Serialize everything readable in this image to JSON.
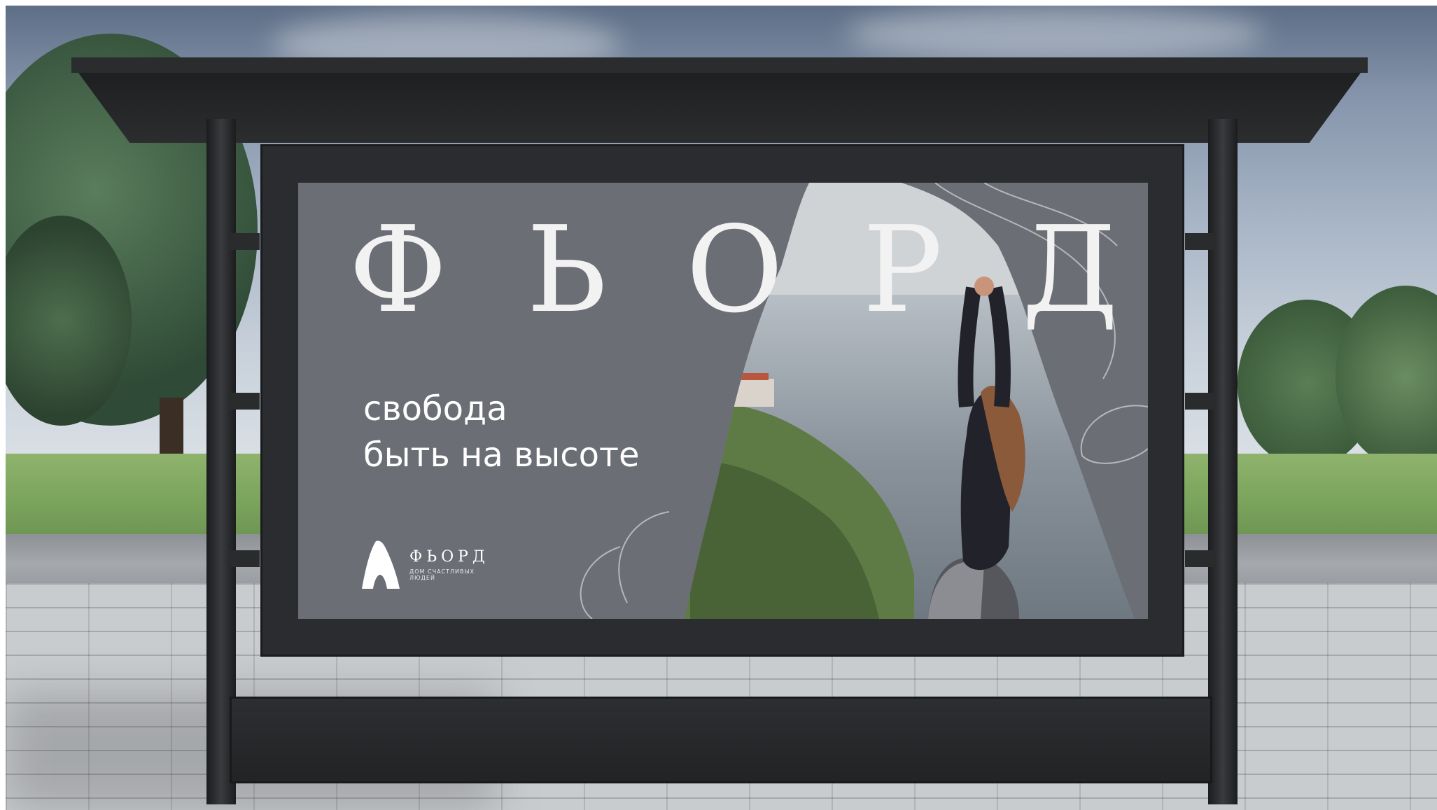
{
  "poster": {
    "brand_title": [
      "Ф",
      "Ь",
      "О",
      "Р",
      "Д"
    ],
    "tagline_line1": "свобода",
    "tagline_line2": "быть на высоте",
    "logo_name": "ФЬОРД",
    "logo_subtitle": "ДОМ СЧАСТЛИВЫХ ЛЮДЕЙ"
  },
  "colors": {
    "poster_background": "#6b6e75",
    "text": "#ffffff",
    "frame": "#2b2c2f"
  }
}
